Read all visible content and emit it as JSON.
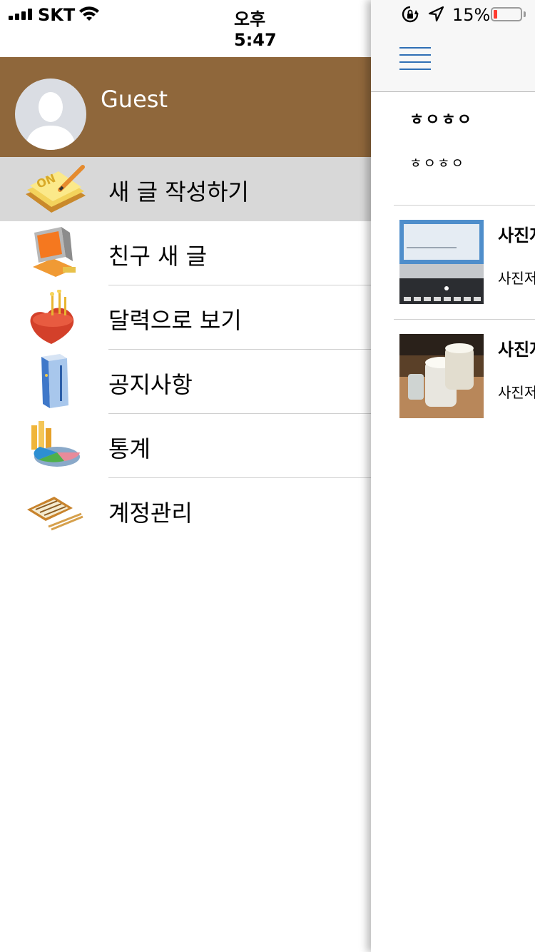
{
  "status_bar": {
    "carrier": "SKT",
    "time": "오후 5:47",
    "battery_percent": "15%",
    "battery_level": 0.15
  },
  "drawer": {
    "username": "Guest",
    "menu": [
      {
        "label": "새 글 작성하기",
        "icon": "notepad-pencil-icon",
        "selected": true
      },
      {
        "label": "친구 새 글",
        "icon": "computer-icon",
        "selected": false
      },
      {
        "label": "달력으로 보기",
        "icon": "heart-cake-icon",
        "selected": false
      },
      {
        "label": "공지사항",
        "icon": "server-tower-icon",
        "selected": false
      },
      {
        "label": "통계",
        "icon": "pie-chart-icon",
        "selected": false
      },
      {
        "label": "계정관리",
        "icon": "abacus-icon",
        "selected": false
      }
    ]
  },
  "main": {
    "post_header": {
      "title": "ㅎㅇㅎㅇ",
      "body": "ㅎㅇㅎㅇ"
    },
    "feed": [
      {
        "title": "사진저",
        "subtitle": "사진저",
        "thumbnail": "laptop-photo"
      },
      {
        "title": "사진저",
        "subtitle": "사진저",
        "thumbnail": "beer-photo"
      }
    ]
  },
  "colors": {
    "drawer_header": "#8f673b",
    "selected_row": "#d8d8d8",
    "hamburger": "#2f6fb5",
    "battery_low": "#ff3b30"
  }
}
